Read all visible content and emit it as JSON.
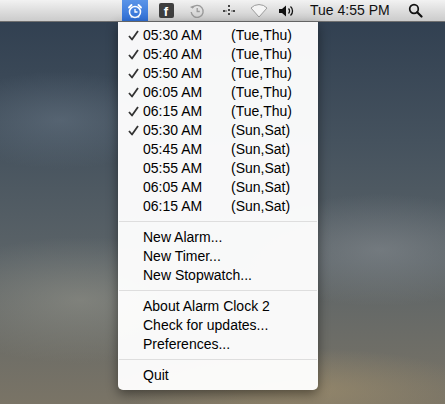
{
  "menu_bar": {
    "alarm_clock_selected": true,
    "facebook_letter": "f",
    "clock": "Tue 4:55 PM"
  },
  "menu": {
    "alarms": [
      {
        "time": "05:30 AM",
        "days": "(Tue,Thu)",
        "checked": true
      },
      {
        "time": "05:40 AM",
        "days": "(Tue,Thu)",
        "checked": true
      },
      {
        "time": "05:50 AM",
        "days": "(Tue,Thu)",
        "checked": true
      },
      {
        "time": "06:05 AM",
        "days": "(Tue,Thu)",
        "checked": true
      },
      {
        "time": "06:15 AM",
        "days": "(Tue,Thu)",
        "checked": true
      },
      {
        "time": "05:30 AM",
        "days": "(Sun,Sat)",
        "checked": true
      },
      {
        "time": "05:45 AM",
        "days": "(Sun,Sat)",
        "checked": false
      },
      {
        "time": "05:55 AM",
        "days": "(Sun,Sat)",
        "checked": false
      },
      {
        "time": "06:05 AM",
        "days": "(Sun,Sat)",
        "checked": false
      },
      {
        "time": "06:15 AM",
        "days": "(Sun,Sat)",
        "checked": false
      }
    ],
    "groups": [
      [
        "New Alarm...",
        "New Timer...",
        "New Stopwatch..."
      ],
      [
        "About Alarm Clock 2",
        "Check for updates...",
        "Preferences..."
      ],
      [
        "Quit"
      ]
    ]
  }
}
